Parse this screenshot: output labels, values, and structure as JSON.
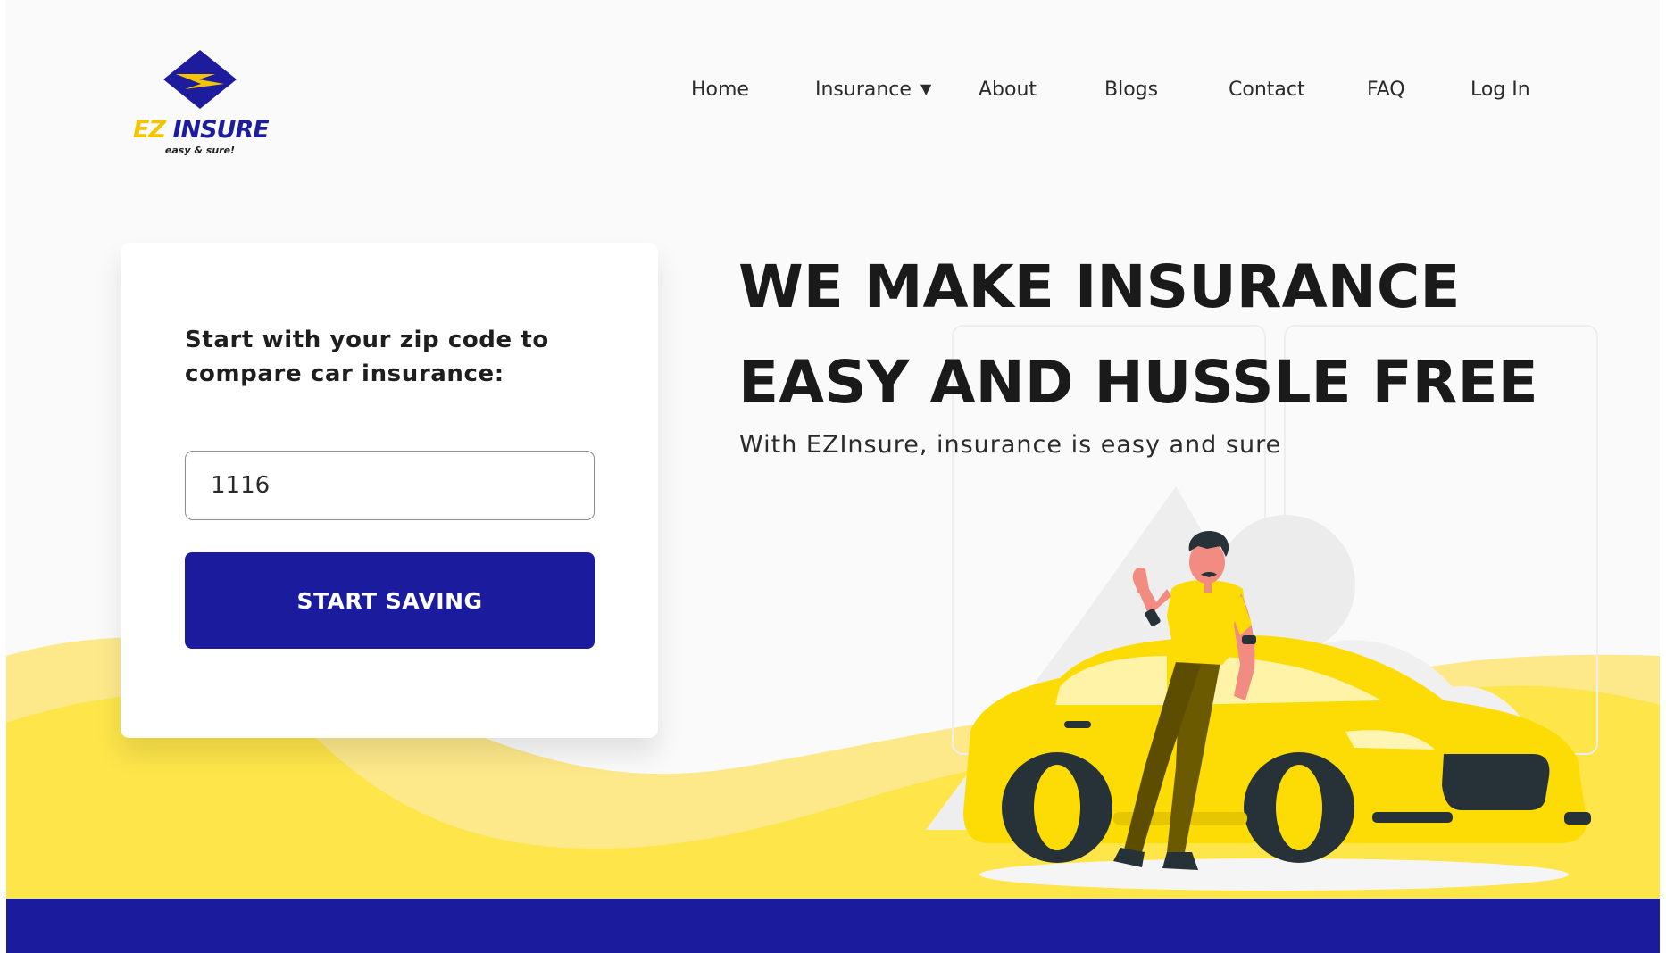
{
  "brand": {
    "name_part1": "EZ",
    "name_part2": "INSURE",
    "tagline": "easy & sure!",
    "colors": {
      "navy": "#1b1b9d",
      "yellow": "#f5c400",
      "light_yellow": "#fde54a"
    }
  },
  "nav": {
    "items": [
      {
        "label": "Home"
      },
      {
        "label": "Insurance",
        "has_dropdown": true
      },
      {
        "label": "About"
      },
      {
        "label": "Blogs"
      },
      {
        "label": "Contact"
      },
      {
        "label": "FAQ"
      },
      {
        "label": "Log In"
      }
    ]
  },
  "quote_form": {
    "title": "Start with your zip code to compare car insurance:",
    "zip_value": "1116",
    "button_label": "START SAVING"
  },
  "hero": {
    "headline_line1": "WE MAKE INSURANCE",
    "headline_line2": "EASY AND HUSSLE FREE",
    "subheadline": "With EZInsure, insurance is easy and sure",
    "illustration": "man-leaning-on-yellow-car"
  }
}
